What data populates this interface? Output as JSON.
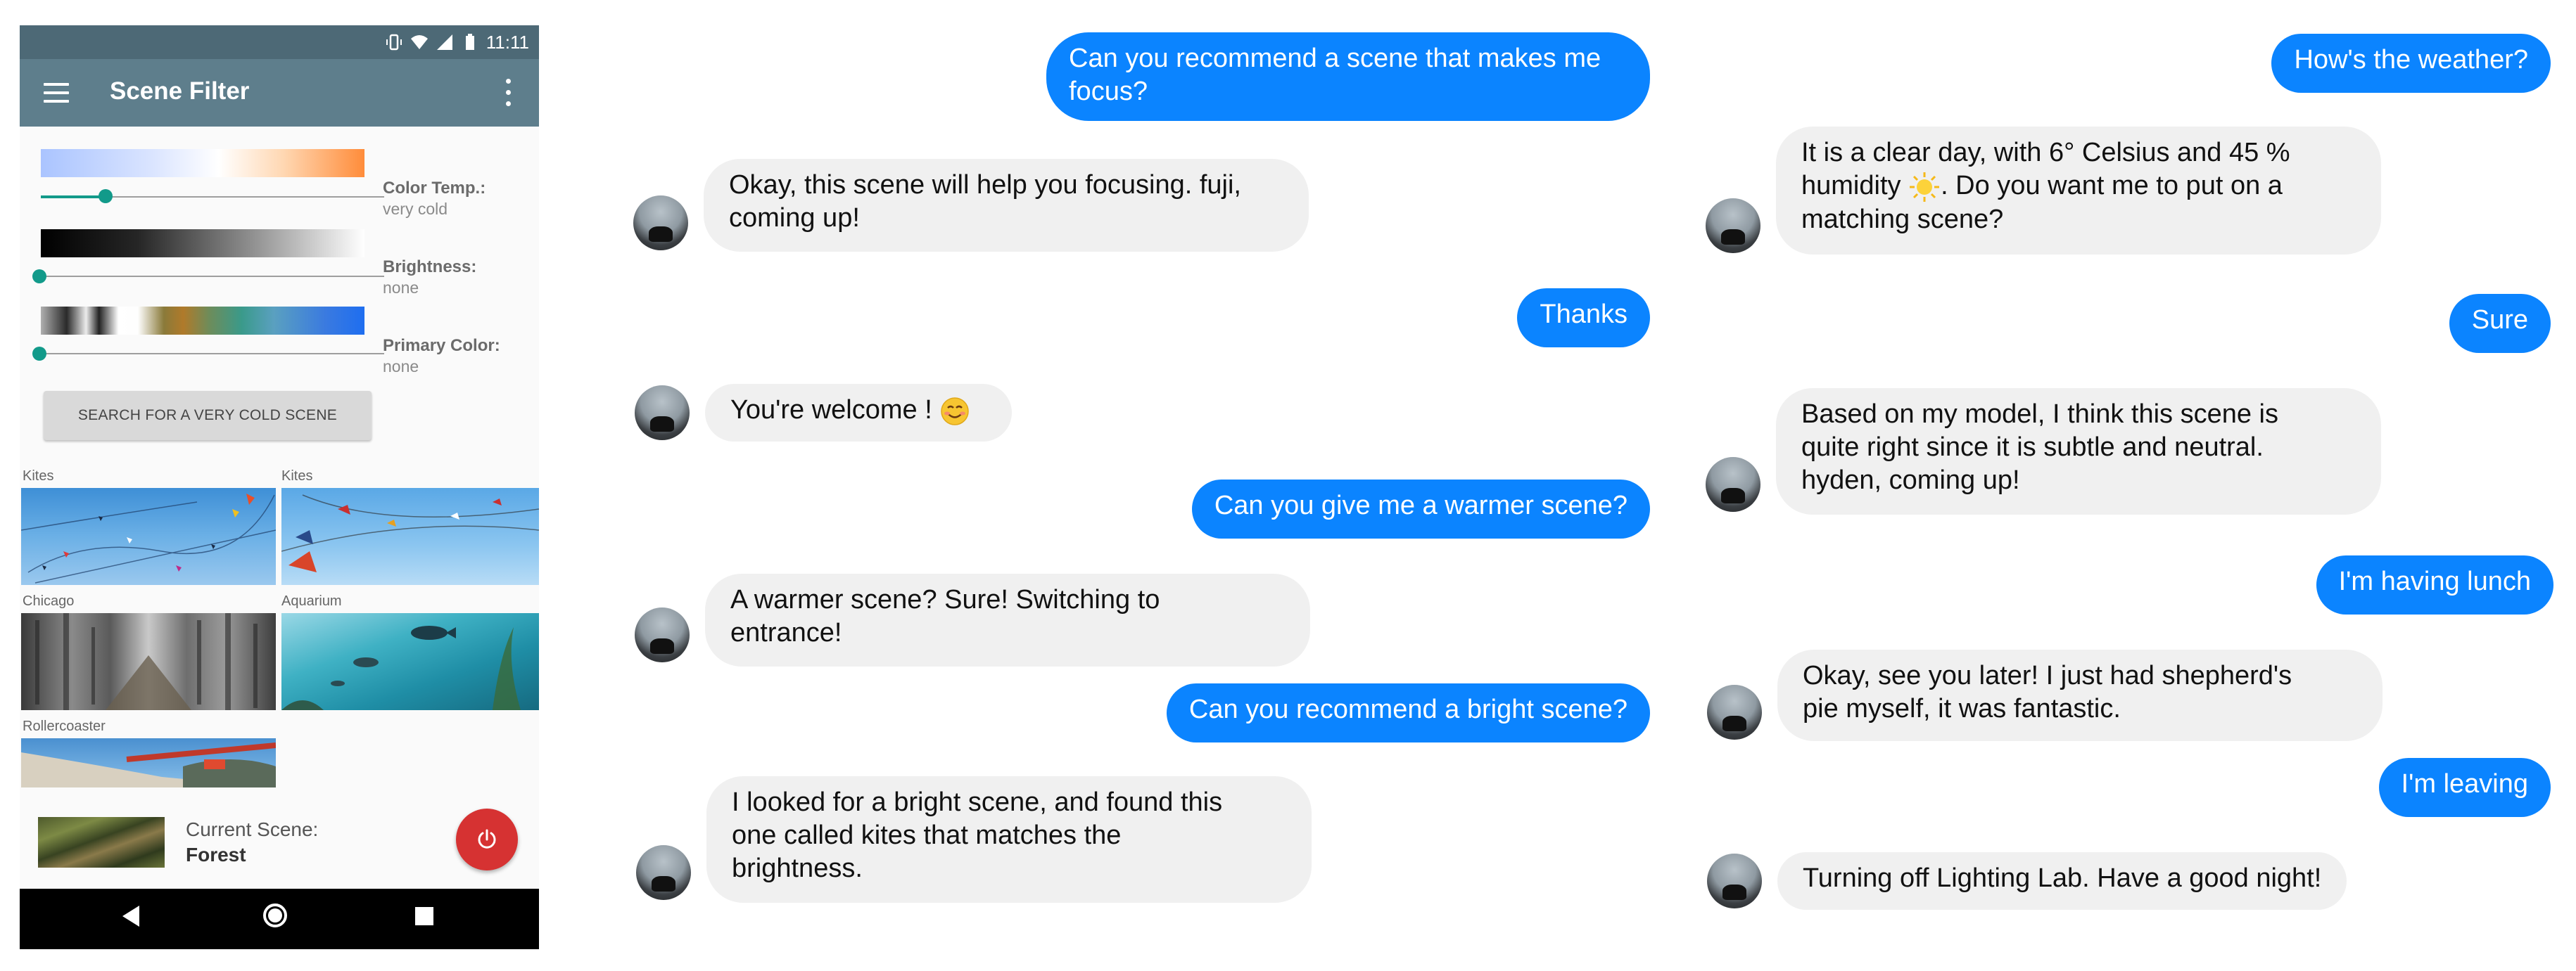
{
  "phone": {
    "status": {
      "time": "11:11"
    },
    "appbar": {
      "title": "Scene Filter"
    },
    "controls": [
      {
        "label": "Color Temp.:",
        "value": "very cold",
        "slider_fraction": 0.2
      },
      {
        "label": "Brightness:",
        "value": "none",
        "slider_fraction": 0.0
      },
      {
        "label": "Primary Color:",
        "value": "none",
        "slider_fraction": 0.0
      }
    ],
    "search_button": "SEARCH FOR A VERY COLD SCENE",
    "scenes": [
      {
        "label": "Kites"
      },
      {
        "label": "Kites"
      },
      {
        "label": "Chicago"
      },
      {
        "label": "Aquarium"
      },
      {
        "label": "Rollercoaster"
      }
    ],
    "current_scene": {
      "label": "Current Scene:",
      "value": "Forest"
    }
  },
  "chat_left": [
    {
      "from": "user",
      "lines": [
        "Can you recommend a scene that makes me",
        "focus?"
      ]
    },
    {
      "from": "bot",
      "lines": [
        "Okay, this scene will help you focusing. fuji,",
        "coming up!"
      ]
    },
    {
      "from": "user",
      "lines": [
        "Thanks"
      ]
    },
    {
      "from": "bot",
      "lines": [
        "You're welcome !"
      ],
      "emoji": "smiling-face"
    },
    {
      "from": "user",
      "lines": [
        "Can you give me a warmer scene?"
      ]
    },
    {
      "from": "bot",
      "lines": [
        "A warmer scene? Sure! Switching to",
        "entrance!"
      ]
    },
    {
      "from": "user",
      "lines": [
        "Can you recommend a bright scene?"
      ]
    },
    {
      "from": "bot",
      "lines": [
        "I looked for a bright scene, and found this",
        "one called kites that matches the",
        "brightness."
      ]
    }
  ],
  "chat_right": [
    {
      "from": "user",
      "lines": [
        "How's the weather?"
      ]
    },
    {
      "from": "bot",
      "lines": [
        "It is a clear day, with 6° Celsius and 45 %",
        "humidity",
        ". Do you want me to put on a",
        "matching scene?"
      ],
      "emoji": "sun"
    },
    {
      "from": "user",
      "lines": [
        "Sure"
      ]
    },
    {
      "from": "bot",
      "lines": [
        "Based on my model, I think this scene is",
        "quite right since it is subtle and neutral.",
        "hyden, coming up!"
      ]
    },
    {
      "from": "user",
      "lines": [
        "I'm having lunch"
      ]
    },
    {
      "from": "bot",
      "lines": [
        "Okay, see you later! I just had shepherd's",
        "pie myself, it was fantastic."
      ]
    },
    {
      "from": "user",
      "lines": [
        "I'm leaving"
      ]
    },
    {
      "from": "bot",
      "lines": [
        "Turning off Lighting Lab. Have a good night!"
      ]
    }
  ],
  "colors": {
    "user_bubble": "#0b84ff",
    "bot_bubble": "#f0f0f0",
    "appbar": "#5e7e8c",
    "slider": "#129a8a",
    "power": "#d63232"
  }
}
